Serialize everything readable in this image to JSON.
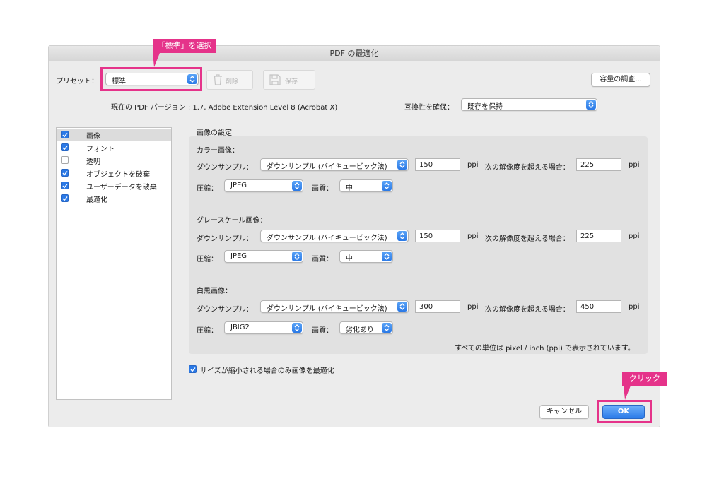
{
  "dialog": {
    "title": "PDF の最適化",
    "preset_label": "プリセット：",
    "preset_value": "標準",
    "delete_label": "削除",
    "save_label": "保存",
    "audit_button": "容量の調査...",
    "version_text": "現在の PDF バージョン : 1.7, Adobe Extension Level 8 (Acrobat X)",
    "compat_label": "互換性を確保：",
    "compat_value": "既存を保持"
  },
  "sidebar": {
    "items": [
      {
        "label": "画像",
        "checked": true
      },
      {
        "label": "フォント",
        "checked": true
      },
      {
        "label": "透明",
        "checked": false
      },
      {
        "label": "オブジェクトを破棄",
        "checked": true
      },
      {
        "label": "ユーザーデータを破棄",
        "checked": true
      },
      {
        "label": "最適化",
        "checked": true
      }
    ]
  },
  "image_settings": {
    "section_title": "画像の設定",
    "downsample_label": "ダウンサンプル：",
    "compress_label": "圧縮：",
    "quality_label": "画質：",
    "ppi_unit": "ppi",
    "threshold_label": "次の解像度を超える場合：",
    "color": {
      "title": "カラー画像：",
      "downsample": "ダウンサンプル (バイキュービック法)",
      "ppi": "150",
      "threshold": "225",
      "compression": "JPEG",
      "quality": "中"
    },
    "grayscale": {
      "title": "グレースケール画像：",
      "downsample": "ダウンサンプル (バイキュービック法)",
      "ppi": "150",
      "threshold": "225",
      "compression": "JPEG",
      "quality": "中"
    },
    "mono": {
      "title": "白黒画像：",
      "downsample": "ダウンサンプル (バイキュービック法)",
      "ppi": "300",
      "threshold": "450",
      "compression": "JBIG2",
      "quality": "劣化あり"
    },
    "unit_note": "すべての単位は pixel / inch (ppi) で表示されています。",
    "optimize_if_smaller": "サイズが縮小される場合のみ画像を最適化"
  },
  "footer": {
    "cancel_label": "キャンセル",
    "ok_label": "OK"
  },
  "annotations": {
    "preset_callout": "「標準」を選択",
    "ok_callout": "クリック"
  },
  "colors": {
    "accent": "#2b79e6",
    "highlight": "#e5338a"
  }
}
